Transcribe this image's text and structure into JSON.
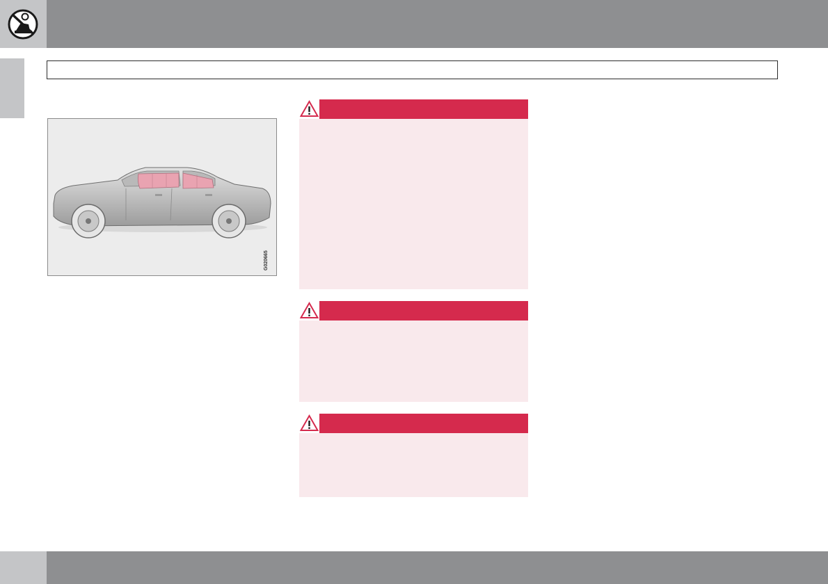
{
  "figure": {
    "code": "G020665",
    "colors": {
      "car_body": "#cfcfcf",
      "curtain_airbag": "#e9a3b1",
      "background": "#ececec"
    }
  },
  "warnings": [
    {
      "icon": "warning-triangle-icon"
    },
    {
      "icon": "warning-triangle-icon"
    },
    {
      "icon": "warning-triangle-icon"
    }
  ],
  "colors": {
    "header_gray": "#8e8f91",
    "tab_gray": "#c4c5c7",
    "warning_red": "#d52a4d",
    "warning_body": "#f9e9ec"
  }
}
